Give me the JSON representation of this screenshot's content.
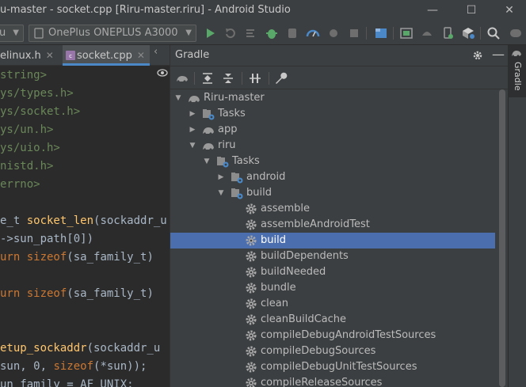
{
  "window": {
    "title": "u-master - socket.cpp [Riru-master.riru] - Android Studio",
    "minimize": "—",
    "maximize": "☐",
    "close": "✕"
  },
  "toolbar": {
    "module_combo": "u",
    "device_combo": "OnePlus ONEPLUS A3000",
    "icons": [
      "run-icon",
      "apply-changes-icon",
      "apply-code-changes-icon",
      "debug-icon",
      "attach-debugger-icon",
      "profile-icon",
      "coverage-icon",
      "stop-icon",
      "project-structure-icon",
      "avd-manager-icon",
      "sdk-manager-icon",
      "device-manager-icon",
      "layout-inspector-icon",
      "search-icon",
      "toggle-icon"
    ]
  },
  "editor": {
    "tabs": [
      {
        "label": "elinux.h",
        "active": false
      },
      {
        "label": "socket.cpp",
        "active": true
      }
    ],
    "lines": [
      [
        {
          "t": "string>",
          "c": "str"
        }
      ],
      [
        {
          "t": "ys/types.h>",
          "c": "str"
        }
      ],
      [
        {
          "t": "ys/socket.h>",
          "c": "str"
        }
      ],
      [
        {
          "t": "ys/un.h>",
          "c": "str"
        }
      ],
      [
        {
          "t": "ys/uio.h>",
          "c": "str"
        }
      ],
      [
        {
          "t": "nistd.h>",
          "c": "str"
        }
      ],
      [
        {
          "t": "errno>",
          "c": "str"
        }
      ],
      [],
      [
        {
          "t": "e_t ",
          "c": ""
        },
        {
          "t": "socket_len",
          "c": "fn"
        },
        {
          "t": "(sockaddr_u",
          "c": ""
        }
      ],
      [
        {
          "t": "->sun_path[0])",
          "c": ""
        }
      ],
      [
        {
          "t": "urn ",
          "c": "kw"
        },
        {
          "t": "sizeof",
          "c": "kw"
        },
        {
          "t": "(sa_family_t)",
          "c": ""
        }
      ],
      [],
      [
        {
          "t": "urn ",
          "c": "kw"
        },
        {
          "t": "sizeof",
          "c": "kw"
        },
        {
          "t": "(sa_family_t)",
          "c": ""
        }
      ],
      [],
      [],
      [
        {
          "t": "etup_sockaddr",
          "c": "fn"
        },
        {
          "t": "(sockaddr_u",
          "c": ""
        }
      ],
      [
        {
          "t": "sun, 0, ",
          "c": ""
        },
        {
          "t": "sizeof",
          "c": "kw"
        },
        {
          "t": "(*sun));",
          "c": ""
        }
      ],
      [
        {
          "t": "un_family = AF_UNIX;",
          "c": ""
        }
      ]
    ]
  },
  "gradle": {
    "title": "Gradle",
    "tree": [
      {
        "label": "Riru-master",
        "level": 0,
        "toggle": "open",
        "icon": "gradle-elephant-icon",
        "selected": false
      },
      {
        "label": "Tasks",
        "level": 1,
        "toggle": "closed",
        "icon": "tasks-folder-icon",
        "selected": false
      },
      {
        "label": "app",
        "level": 1,
        "toggle": "closed",
        "icon": "gradle-elephant-icon",
        "selected": false
      },
      {
        "label": "riru",
        "level": 1,
        "toggle": "open",
        "icon": "gradle-elephant-icon",
        "selected": false
      },
      {
        "label": "Tasks",
        "level": 2,
        "toggle": "open",
        "icon": "tasks-folder-icon",
        "selected": false
      },
      {
        "label": "android",
        "level": 3,
        "toggle": "closed",
        "icon": "tasks-folder-icon",
        "selected": false
      },
      {
        "label": "build",
        "level": 3,
        "toggle": "open",
        "icon": "tasks-folder-icon",
        "selected": false
      },
      {
        "label": "assemble",
        "level": 4,
        "toggle": "none",
        "icon": "gear-icon",
        "selected": false
      },
      {
        "label": "assembleAndroidTest",
        "level": 4,
        "toggle": "none",
        "icon": "gear-icon",
        "selected": false
      },
      {
        "label": "build",
        "level": 4,
        "toggle": "none",
        "icon": "gear-icon",
        "selected": true
      },
      {
        "label": "buildDependents",
        "level": 4,
        "toggle": "none",
        "icon": "gear-icon",
        "selected": false
      },
      {
        "label": "buildNeeded",
        "level": 4,
        "toggle": "none",
        "icon": "gear-icon",
        "selected": false
      },
      {
        "label": "bundle",
        "level": 4,
        "toggle": "none",
        "icon": "gear-icon",
        "selected": false
      },
      {
        "label": "clean",
        "level": 4,
        "toggle": "none",
        "icon": "gear-icon",
        "selected": false
      },
      {
        "label": "cleanBuildCache",
        "level": 4,
        "toggle": "none",
        "icon": "gear-icon",
        "selected": false
      },
      {
        "label": "compileDebugAndroidTestSources",
        "level": 4,
        "toggle": "none",
        "icon": "gear-icon",
        "selected": false
      },
      {
        "label": "compileDebugSources",
        "level": 4,
        "toggle": "none",
        "icon": "gear-icon",
        "selected": false
      },
      {
        "label": "compileDebugUnitTestSources",
        "level": 4,
        "toggle": "none",
        "icon": "gear-icon",
        "selected": false
      },
      {
        "label": "compileReleaseSources",
        "level": 4,
        "toggle": "none",
        "icon": "gear-icon",
        "selected": false
      }
    ]
  },
  "side_panel": {
    "label": "Gradle"
  },
  "colors": {
    "selection": "#4b6eaf",
    "string": "#6a8759",
    "keyword": "#cc7832",
    "function": "#ffc66d",
    "text": "#a9b7c6"
  }
}
